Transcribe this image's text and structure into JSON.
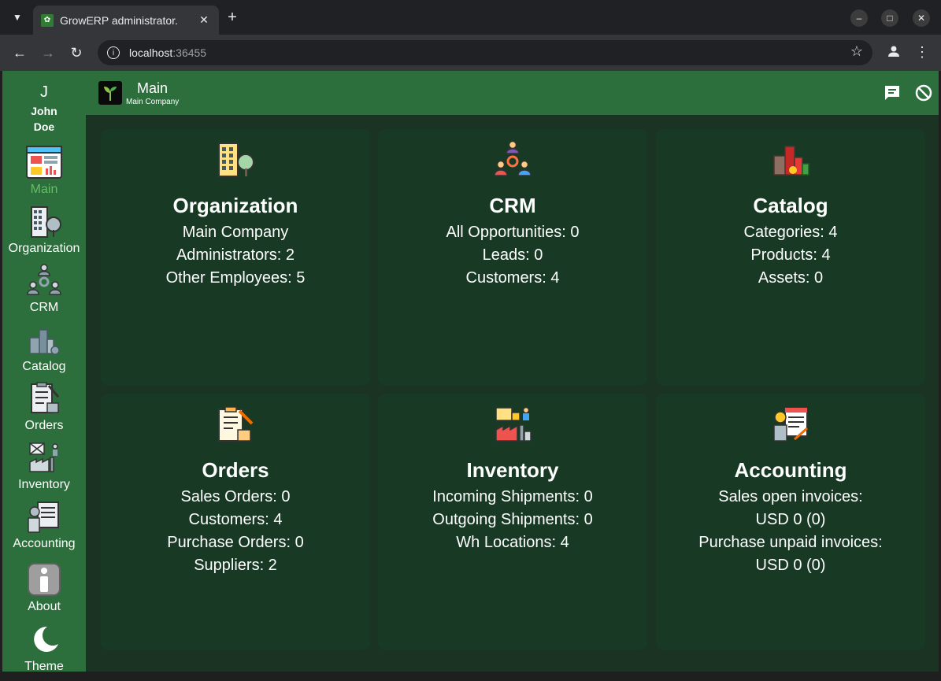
{
  "browser": {
    "tab_title": "GrowERP administrator.",
    "url_host": "localhost",
    "url_port": ":36455"
  },
  "rail": {
    "user_initial": "J",
    "user_first": "John",
    "user_last": "Doe",
    "items": [
      {
        "label": "Main",
        "icon": "dashboard-icon"
      },
      {
        "label": "Organization",
        "icon": "building-icon"
      },
      {
        "label": "CRM",
        "icon": "people-network-icon"
      },
      {
        "label": "Catalog",
        "icon": "products-icon"
      },
      {
        "label": "Orders",
        "icon": "clipboard-icon"
      },
      {
        "label": "Inventory",
        "icon": "warehouse-icon"
      },
      {
        "label": "Accounting",
        "icon": "ledger-icon"
      },
      {
        "label": "About",
        "icon": "info-icon"
      },
      {
        "label": "Theme",
        "icon": "moon-icon"
      }
    ]
  },
  "header": {
    "title": "Main",
    "subtitle": "Main Company"
  },
  "cards": [
    {
      "title": "Organization",
      "icon": "building-icon",
      "lines": [
        "Main Company",
        "Administrators: 2",
        "Other Employees: 5"
      ]
    },
    {
      "title": "CRM",
      "icon": "people-network-icon",
      "lines": [
        "All Opportunities: 0",
        "Leads: 0",
        "Customers: 4"
      ]
    },
    {
      "title": "Catalog",
      "icon": "products-icon",
      "lines": [
        "Categories: 4",
        "Products: 4",
        "Assets: 0"
      ]
    },
    {
      "title": "Orders",
      "icon": "clipboard-icon",
      "lines": [
        "Sales Orders: 0",
        "Customers: 4",
        "Purchase Orders: 0",
        "Suppliers: 2"
      ]
    },
    {
      "title": "Inventory",
      "icon": "warehouse-icon",
      "lines": [
        "Incoming Shipments: 0",
        "Outgoing Shipments: 0",
        "Wh Locations: 4"
      ]
    },
    {
      "title": "Accounting",
      "icon": "ledger-icon",
      "lines": [
        "Sales open invoices:",
        "USD 0 (0)",
        "Purchase unpaid invoices:",
        "USD 0 (0)"
      ]
    }
  ]
}
